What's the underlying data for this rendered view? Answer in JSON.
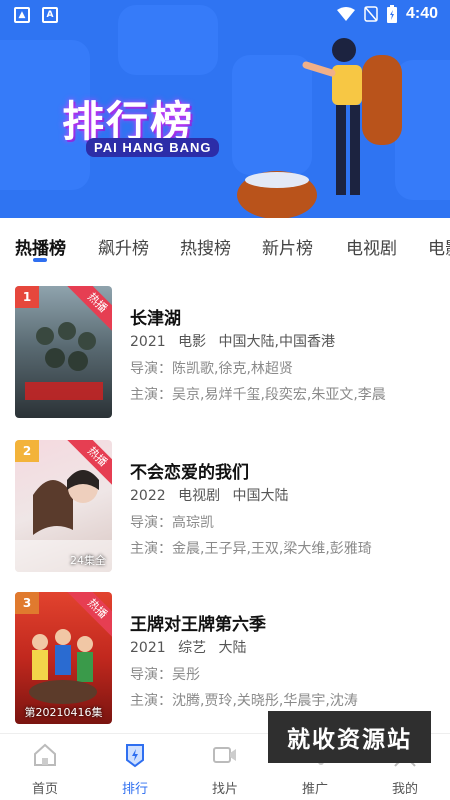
{
  "status_bar": {
    "time": "4:40",
    "notif_a": "A"
  },
  "hero": {
    "title": "排行榜",
    "subtitle": "PAI HANG BANG",
    "accent": "#2f74f2"
  },
  "tabs": [
    {
      "label": "热播榜"
    },
    {
      "label": "飙升榜"
    },
    {
      "label": "热搜榜"
    },
    {
      "label": "新片榜"
    },
    {
      "label": "电视剧"
    },
    {
      "label": "电影"
    }
  ],
  "items": [
    {
      "rank": "1",
      "badge": "热播",
      "rank_color": "#e6473c",
      "title": "长津湖",
      "year": "2021",
      "type": "电影",
      "region": "中国大陆,中国香港",
      "director": "导演：陈凯歌,徐克,林超贤",
      "cast": "主演：吴京,易烊千玺,段奕宏,朱亚文,李晨",
      "poster_caption": ""
    },
    {
      "rank": "2",
      "badge": "热播",
      "rank_color": "#f3b33a",
      "title": "不会恋爱的我们",
      "year": "2022",
      "type": "电视剧",
      "region": "中国大陆",
      "director": "导演：高琮凯",
      "cast": "主演：金晨,王子异,王双,梁大维,彭雅琦",
      "poster_caption": "24集全"
    },
    {
      "rank": "3",
      "badge": "热播",
      "rank_color": "#e07a2e",
      "title": "王牌对王牌第六季",
      "year": "2021",
      "type": "综艺",
      "region": "大陆",
      "director": "导演：吴彤",
      "cast": "主演：沈腾,贾玲,关晓彤,华晨宇,沈涛",
      "poster_caption": "第20210416集"
    }
  ],
  "watermark": "就收资源站",
  "bottom_nav": [
    {
      "label": "首页",
      "icon": "home-icon"
    },
    {
      "label": "排行",
      "icon": "ranking-icon"
    },
    {
      "label": "找片",
      "icon": "video-camera-icon"
    },
    {
      "label": "推广",
      "icon": "share-icon"
    },
    {
      "label": "我的",
      "icon": "profile-icon"
    }
  ]
}
